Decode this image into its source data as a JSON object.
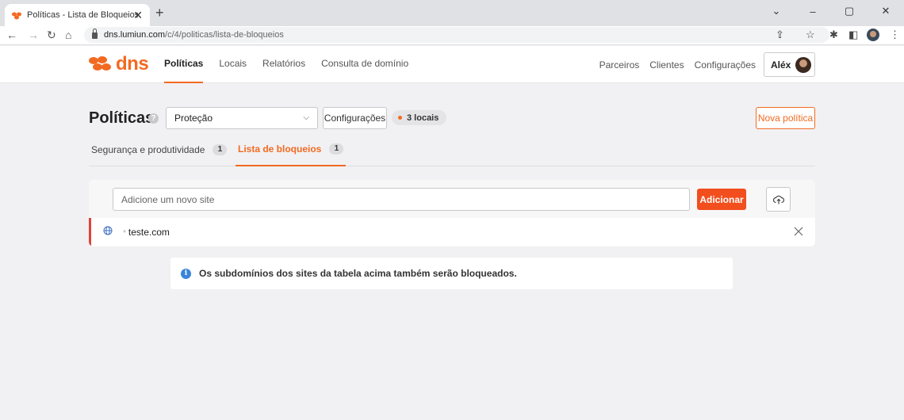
{
  "browser": {
    "tab_title": "Políticas - Lista de Bloqueios - Lu",
    "url_host": "dns.lumiun.com",
    "url_path": "/c/4/politicas/lista-de-bloqueios"
  },
  "app": {
    "logo_text": "dns",
    "brand_color": "#f26a21",
    "nav": {
      "politicas": "Políticas",
      "locais": "Locais",
      "relatorios": "Relatórios",
      "consulta": "Consulta de domínio"
    },
    "right_nav": {
      "parceiros": "Parceiros",
      "clientes": "Clientes",
      "configuracoes": "Configurações"
    },
    "user_name": "Aléx"
  },
  "page": {
    "title": "Políticas",
    "help_symbol": "?",
    "policy_selected": "Proteção",
    "config_button": "Configurações",
    "locais_badge": "3 locais",
    "new_policy_button": "Nova política",
    "tabs": [
      {
        "label": "Segurança e produtividade",
        "count": "1"
      },
      {
        "label": "Lista de bloqueios",
        "count": "1"
      }
    ]
  },
  "blocklist": {
    "input_placeholder": "Adicione um novo site",
    "add_button": "Adicionar",
    "items": [
      {
        "prefix": "*",
        "domain": "teste.com"
      }
    ],
    "accent_color": "#e0433a"
  },
  "info": {
    "icon_symbol": "i",
    "message": "Os subdomínios dos sites da tabela acima também serão bloqueados."
  }
}
